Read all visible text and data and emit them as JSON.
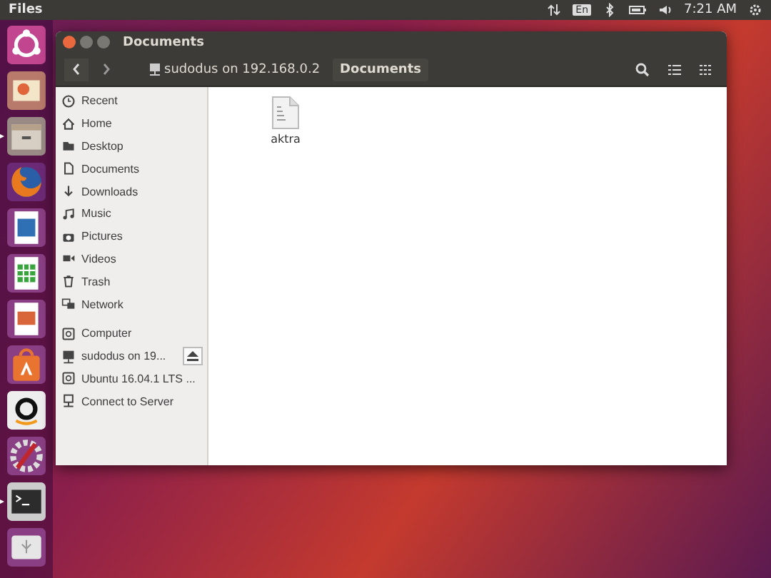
{
  "top_bar": {
    "app_title": "Files",
    "keyboard": "En",
    "clock": "7:21 AM"
  },
  "launcher": [
    {
      "kind": "ubuntu",
      "running": false
    },
    {
      "kind": "photos",
      "running": false
    },
    {
      "kind": "files",
      "running": true
    },
    {
      "kind": "firefox",
      "running": false
    },
    {
      "kind": "writer",
      "running": false
    },
    {
      "kind": "calc",
      "running": false
    },
    {
      "kind": "impress",
      "running": false
    },
    {
      "kind": "software",
      "running": false
    },
    {
      "kind": "amazon",
      "running": false
    },
    {
      "kind": "settings",
      "running": false
    },
    {
      "kind": "terminal",
      "running": true
    },
    {
      "kind": "drive",
      "running": false
    }
  ],
  "window": {
    "title": "Documents"
  },
  "path_bar": [
    {
      "label": "sudodus on 192.168.0.2",
      "selected": false
    },
    {
      "label": "Documents",
      "selected": true
    }
  ],
  "sidebar": {
    "places": [
      {
        "label": "Recent",
        "kind": "recent"
      },
      {
        "label": "Home",
        "kind": "home"
      },
      {
        "label": "Desktop",
        "kind": "folder"
      },
      {
        "label": "Documents",
        "kind": "doc"
      },
      {
        "label": "Downloads",
        "kind": "download"
      },
      {
        "label": "Music",
        "kind": "music"
      },
      {
        "label": "Pictures",
        "kind": "camera"
      },
      {
        "label": "Videos",
        "kind": "video"
      },
      {
        "label": "Trash",
        "kind": "trash"
      },
      {
        "label": "Network",
        "kind": "network"
      }
    ],
    "devices": [
      {
        "label": "Computer",
        "kind": "drive",
        "ejectable": false
      },
      {
        "label": "sudodus on 19...",
        "kind": "share",
        "ejectable": true
      },
      {
        "label": "Ubuntu 16.04.1 LTS ...",
        "kind": "drive",
        "ejectable": false
      },
      {
        "label": "Connect to Server",
        "kind": "server",
        "ejectable": false
      }
    ]
  },
  "files": [
    {
      "name": "aktra"
    }
  ]
}
